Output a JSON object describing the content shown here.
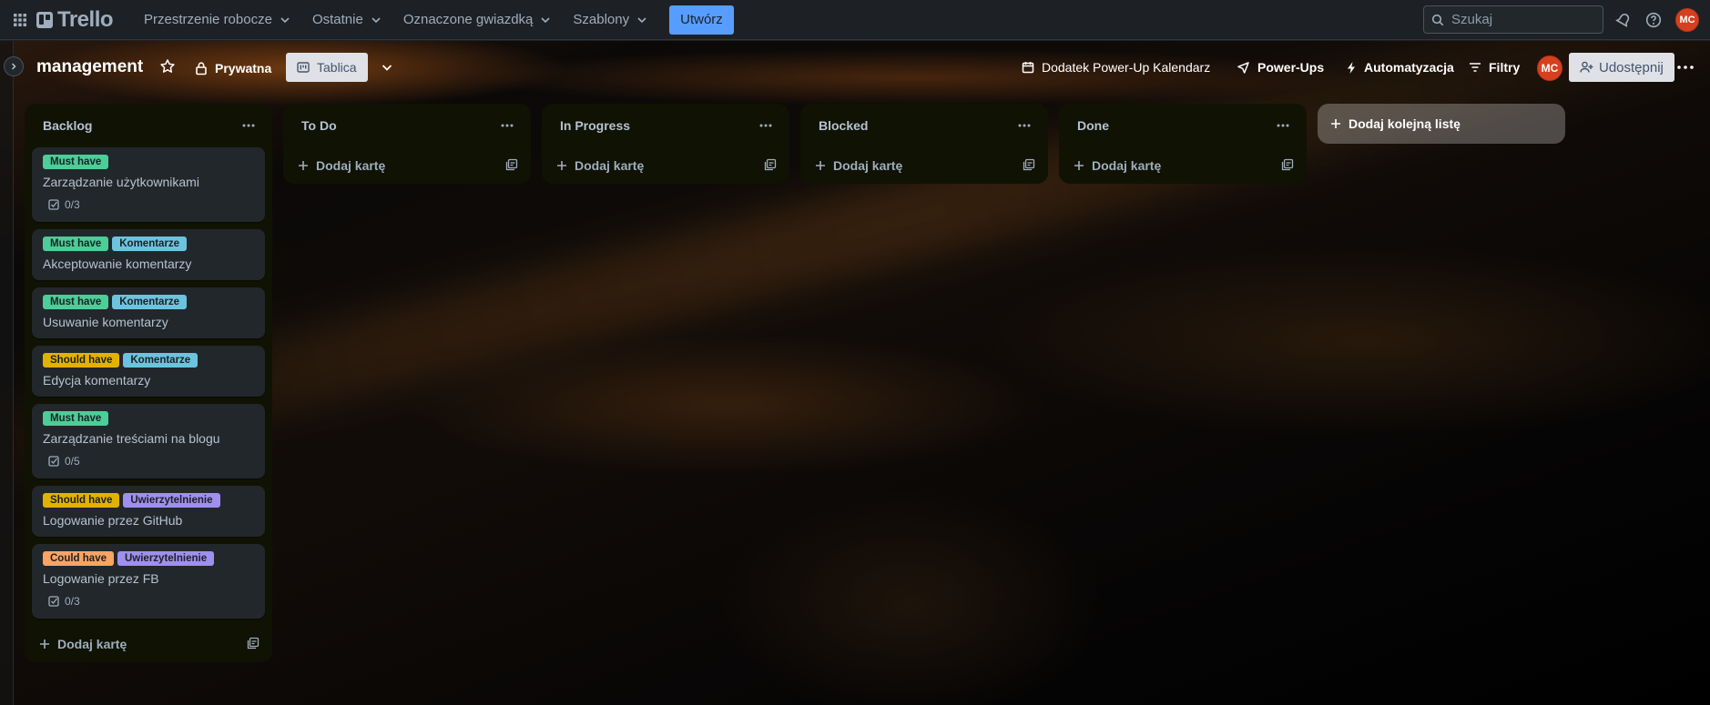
{
  "topnav": {
    "app_name": "Trello",
    "items": [
      {
        "label": "Przestrzenie robocze"
      },
      {
        "label": "Ostatnie"
      },
      {
        "label": "Oznaczone gwiazdką"
      },
      {
        "label": "Szablony"
      }
    ],
    "create_label": "Utwórz",
    "search_placeholder": "Szukaj",
    "user_initials": "MC"
  },
  "board": {
    "title": "management",
    "visibility": "Prywatna",
    "view_label": "Tablica",
    "calendar_label": "Dodatek Power-Up Kalendarz",
    "powerups_label": "Power-Ups",
    "automation_label": "Automatyzacja",
    "filters_label": "Filtry",
    "member_initials": "MC",
    "share_label": "Udostępnij",
    "add_list_label": "Dodaj kolejną listę"
  },
  "colors": {
    "must_have": "#4bce97",
    "should_have": "#e2b203",
    "could_have": "#fea362",
    "komentarze": "#6cc3e0",
    "uwierzytelnienie": "#9f8fef",
    "primary": "#579dff"
  },
  "lists": [
    {
      "title": "Backlog",
      "add_card_label": "Dodaj kartę",
      "cards": [
        {
          "labels": [
            {
              "text": "Must have",
              "color": "#4bce97"
            }
          ],
          "title": "Zarządzanie użytkownikami",
          "checklist": "0/3"
        },
        {
          "labels": [
            {
              "text": "Must have",
              "color": "#4bce97"
            },
            {
              "text": "Komentarze",
              "color": "#6cc3e0"
            }
          ],
          "title": "Akceptowanie komentarzy"
        },
        {
          "labels": [
            {
              "text": "Must have",
              "color": "#4bce97"
            },
            {
              "text": "Komentarze",
              "color": "#6cc3e0"
            }
          ],
          "title": "Usuwanie komentarzy"
        },
        {
          "labels": [
            {
              "text": "Should have",
              "color": "#e2b203"
            },
            {
              "text": "Komentarze",
              "color": "#6cc3e0"
            }
          ],
          "title": "Edycja komentarzy"
        },
        {
          "labels": [
            {
              "text": "Must have",
              "color": "#4bce97"
            }
          ],
          "title": "Zarządzanie treściami na blogu",
          "checklist": "0/5"
        },
        {
          "labels": [
            {
              "text": "Should have",
              "color": "#e2b203"
            },
            {
              "text": "Uwierzytelnienie",
              "color": "#9f8fef"
            }
          ],
          "title": "Logowanie przez GitHub"
        },
        {
          "labels": [
            {
              "text": "Could have",
              "color": "#fea362"
            },
            {
              "text": "Uwierzytelnienie",
              "color": "#9f8fef"
            }
          ],
          "title": "Logowanie przez FB",
          "checklist": "0/3"
        }
      ]
    },
    {
      "title": "To Do",
      "add_card_label": "Dodaj kartę",
      "cards": []
    },
    {
      "title": "In Progress",
      "add_card_label": "Dodaj kartę",
      "cards": []
    },
    {
      "title": "Blocked",
      "add_card_label": "Dodaj kartę",
      "cards": []
    },
    {
      "title": "Done",
      "add_card_label": "Dodaj kartę",
      "cards": []
    }
  ]
}
